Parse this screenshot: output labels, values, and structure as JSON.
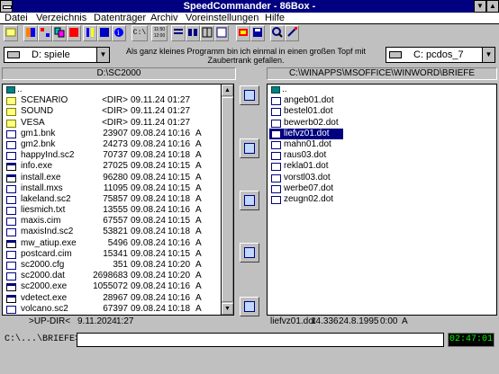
{
  "window": {
    "title": "SpeedCommander - 86Box -",
    "minimize_glyph": "▼",
    "maximize_glyph": "▲"
  },
  "menu": [
    "Datei",
    "Verzeichnis",
    "Datenträger",
    "Archiv",
    "Voreinstellungen",
    "Hilfe"
  ],
  "toolbar": {
    "buttons": [
      "open-icon",
      "view-icon",
      "tree-icon",
      "copy-icon",
      "tools-icon",
      "find-icon",
      "info-icon",
      "dos-prompt-icon",
      "clock-icon",
      "list-icon",
      "details-icon",
      "columns-icon",
      "split-icon",
      "pack-icon",
      "floppy-icon",
      "search-icon",
      "edit-icon"
    ],
    "dos_label": "C:\\",
    "clock_label_1": "11:50",
    "clock_label_2": "12:00"
  },
  "left_drive": {
    "label": "D: spiele"
  },
  "right_drive": {
    "label": "C: pcdos_7"
  },
  "tip_text": "Als ganz kleines Programm bin ich einmal in einen großen Topf mit Zaubertrank gefallen.",
  "left_panel": {
    "path": "D:\\SC2000",
    "updir_glyph": "..",
    "rows": [
      {
        "name": "SCENARIO",
        "size": "<DIR>",
        "date": "09.11.24",
        "time": "01:27",
        "attr": "",
        "type": "folder"
      },
      {
        "name": "SOUND",
        "size": "<DIR>",
        "date": "09.11.24",
        "time": "01:27",
        "attr": "",
        "type": "folder"
      },
      {
        "name": "VESA",
        "size": "<DIR>",
        "date": "09.11.24",
        "time": "01:27",
        "attr": "",
        "type": "folder"
      },
      {
        "name": "gm1.bnk",
        "size": "23907",
        "date": "09.08.24",
        "time": "10:16",
        "attr": "A",
        "type": "file"
      },
      {
        "name": "gm2.bnk",
        "size": "24273",
        "date": "09.08.24",
        "time": "10:16",
        "attr": "A",
        "type": "file"
      },
      {
        "name": "happyInd.sc2",
        "size": "70737",
        "date": "09.08.24",
        "time": "10:18",
        "attr": "A",
        "type": "file"
      },
      {
        "name": "info.exe",
        "size": "27025",
        "date": "09.08.24",
        "time": "10:15",
        "attr": "A",
        "type": "exe"
      },
      {
        "name": "install.exe",
        "size": "96280",
        "date": "09.08.24",
        "time": "10:15",
        "attr": "A",
        "type": "exe"
      },
      {
        "name": "install.mxs",
        "size": "11095",
        "date": "09.08.24",
        "time": "10:15",
        "attr": "A",
        "type": "file"
      },
      {
        "name": "lakeland.sc2",
        "size": "75857",
        "date": "09.08.24",
        "time": "10:18",
        "attr": "A",
        "type": "file"
      },
      {
        "name": "liesmich.txt",
        "size": "13555",
        "date": "09.08.24",
        "time": "10:16",
        "attr": "A",
        "type": "file"
      },
      {
        "name": "maxis.cim",
        "size": "67557",
        "date": "09.08.24",
        "time": "10:15",
        "attr": "A",
        "type": "file"
      },
      {
        "name": "maxisInd.sc2",
        "size": "53821",
        "date": "09.08.24",
        "time": "10:18",
        "attr": "A",
        "type": "file"
      },
      {
        "name": "mw_atiup.exe",
        "size": "5496",
        "date": "09.08.24",
        "time": "10:16",
        "attr": "A",
        "type": "exe"
      },
      {
        "name": "postcard.cim",
        "size": "15341",
        "date": "09.08.24",
        "time": "10:15",
        "attr": "A",
        "type": "file"
      },
      {
        "name": "sc2000.cfg",
        "size": "351",
        "date": "09.08.24",
        "time": "10:20",
        "attr": "A",
        "type": "file"
      },
      {
        "name": "sc2000.dat",
        "size": "2698683",
        "date": "09.08.24",
        "time": "10:20",
        "attr": "A",
        "type": "file"
      },
      {
        "name": "sc2000.exe",
        "size": "1055072",
        "date": "09.08.24",
        "time": "10:16",
        "attr": "A",
        "type": "exe"
      },
      {
        "name": "vdetect.exe",
        "size": "28967",
        "date": "09.08.24",
        "time": "10:16",
        "attr": "A",
        "type": "exe"
      },
      {
        "name": "volcano.sc2",
        "size": "67397",
        "date": "09.08.24",
        "time": "10:18",
        "attr": "A",
        "type": "file"
      }
    ],
    "status": {
      "name": ">UP-DIR<",
      "date": "9.11.2024",
      "time": "1:27"
    }
  },
  "right_panel": {
    "path": "C:\\WINAPPS\\MSOFFICE\\WINWORD\\BRIEFE",
    "updir_glyph": "..",
    "rows": [
      {
        "name": "angeb01.dot",
        "selected": false
      },
      {
        "name": "bestel01.dot",
        "selected": false
      },
      {
        "name": "bewerb02.dot",
        "selected": false
      },
      {
        "name": "liefvz01.dot",
        "selected": true
      },
      {
        "name": "mahn01.dot",
        "selected": false
      },
      {
        "name": "raus03.dot",
        "selected": false
      },
      {
        "name": "rekla01.dot",
        "selected": false
      },
      {
        "name": "vorstl03.dot",
        "selected": false
      },
      {
        "name": "werbe07.dot",
        "selected": false
      },
      {
        "name": "zeugn02.dot",
        "selected": false
      }
    ],
    "status": {
      "name": "liefvz01.dot",
      "size": "14.336",
      "date": "24.8.1995",
      "time": "0:00",
      "attr": "A"
    }
  },
  "middle_buttons": [
    "compare-icon",
    "sync-icon",
    "find-files-icon",
    "edit-icon",
    "exit-icon"
  ],
  "command_line": {
    "prompt": "C:\\...\\BRIEFE>",
    "value": ""
  },
  "clock": {
    "time": "02:47:01"
  }
}
